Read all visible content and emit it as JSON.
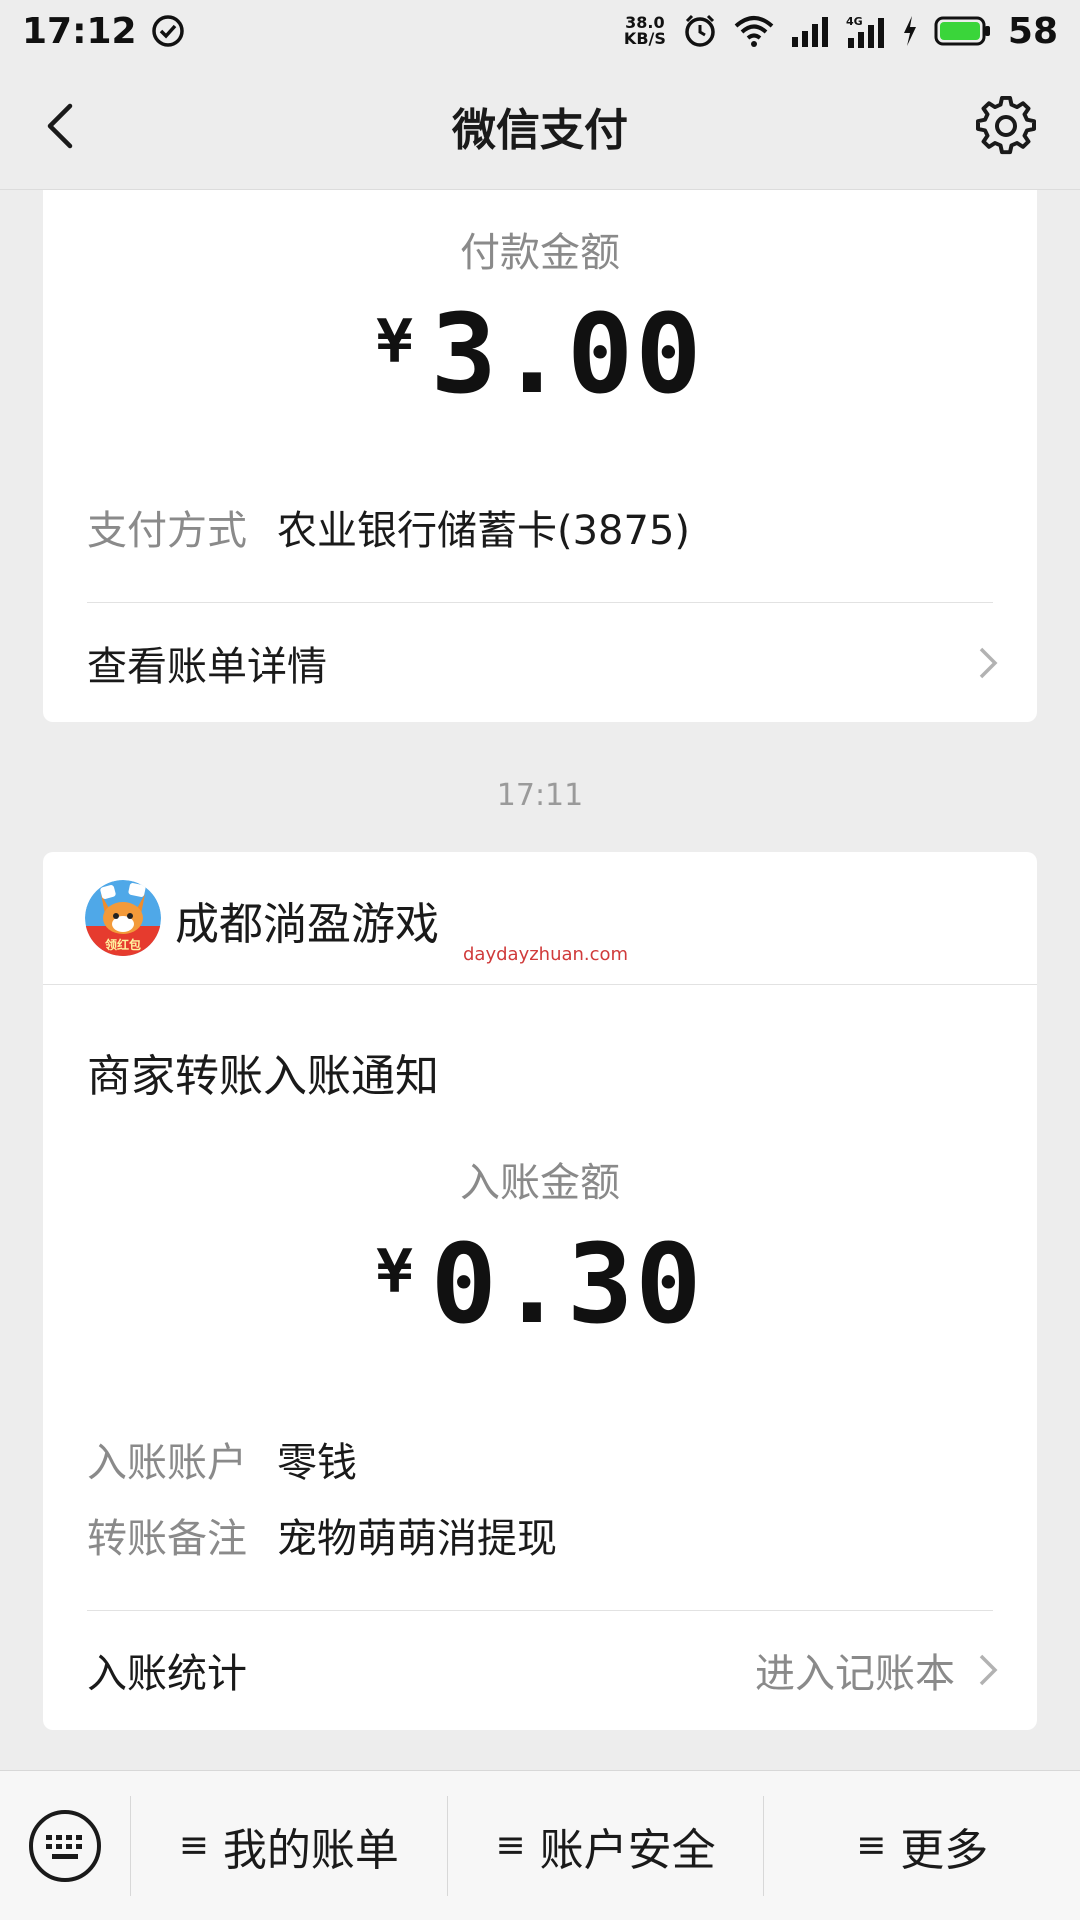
{
  "status_bar": {
    "time": "17:12",
    "net_speed_value": "38.0",
    "net_speed_unit": "KB/S",
    "battery": "58",
    "network_type": "4G"
  },
  "nav": {
    "title": "微信支付"
  },
  "payment_card": {
    "amount_label": "付款金额",
    "currency": "¥",
    "amount": "3.00",
    "method_key": "支付方式",
    "method_value": "农业银行储蓄卡(3875)",
    "detail_link": "查看账单详情"
  },
  "timestamp": "17:11",
  "transfer_card": {
    "merchant_name": "成都淌盈游戏",
    "avatar_text": "领红包",
    "watermark": "daydayzhuan.com",
    "notice_title": "商家转账入账通知",
    "amount_label": "入账金额",
    "currency": "¥",
    "amount": "0.30",
    "account_key": "入账账户",
    "account_value": "零钱",
    "remark_key": "转账备注",
    "remark_value": "宠物萌萌消提现",
    "stats_label": "入账统计",
    "stats_link": "进入记账本"
  },
  "bottom_bar": {
    "items": [
      {
        "glyph": "≡",
        "label": "我的账单"
      },
      {
        "glyph": "≡",
        "label": "账户安全"
      },
      {
        "glyph": "≡",
        "label": "更多"
      }
    ]
  },
  "colors": {
    "background": "#ededed",
    "card": "#ffffff",
    "battery_green": "#3ad53a",
    "watermark_red": "#d03b3b"
  }
}
